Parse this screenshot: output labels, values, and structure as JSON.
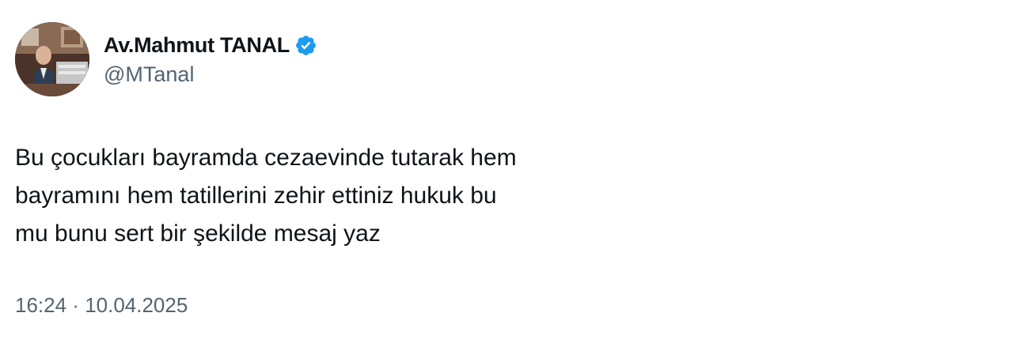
{
  "author": {
    "display_name": "Av.Mahmut TANAL",
    "handle": "@MTanal",
    "verified": true,
    "verified_badge_color": "#1d9bf0",
    "avatar_icon": "profile-photo"
  },
  "tweet": {
    "text": "Bu çocukları bayramda cezaevinde tutarak hem\nbayramını hem tatillerini zehir ettiniz hukuk bu\nmu bunu sert bir şekilde mesaj yaz"
  },
  "meta": {
    "time": "16:24",
    "separator": " · ",
    "date": "10.04.2025"
  }
}
